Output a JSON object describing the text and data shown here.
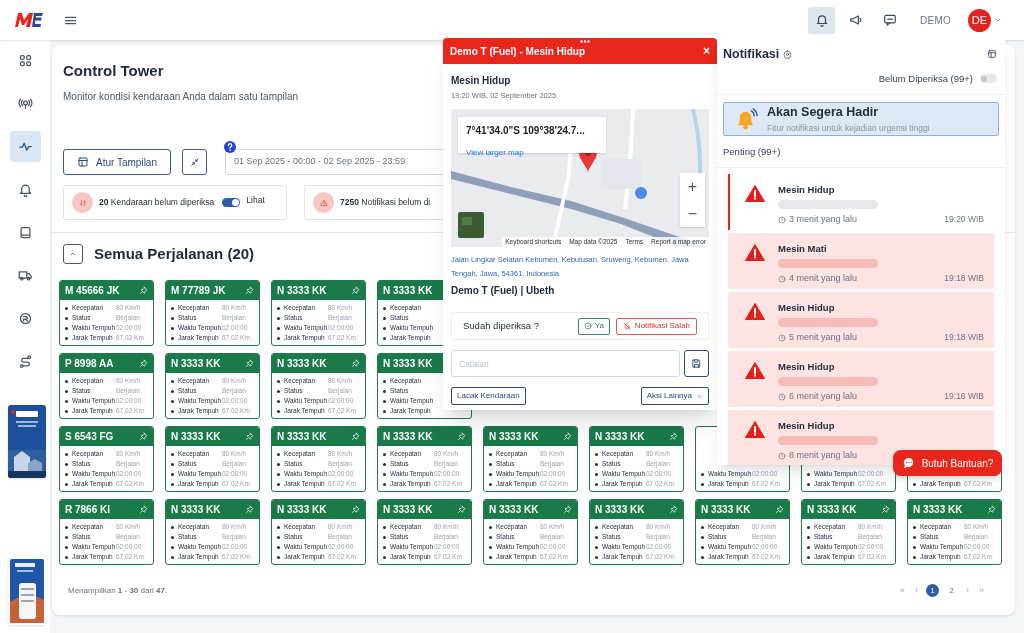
{
  "header": {
    "icons": [
      {
        "selected": true
      },
      {
        "selected": false
      },
      {
        "selected": false
      }
    ],
    "user": "DEMO",
    "avatar": "DE"
  },
  "sidebar": {
    "items": [
      {
        "selected": false
      },
      {
        "selected": false
      },
      {
        "selected": true
      },
      {
        "selected": false
      },
      {
        "selected": false
      },
      {
        "selected": false
      },
      {
        "selected": false
      },
      {
        "selected": false
      }
    ]
  },
  "page": {
    "title": "Control Tower",
    "subtitle": "Monitor kondisi kendaraan Anda dalam satu tampilan"
  },
  "toolbar": {
    "layout_button": "Atur Tampilan",
    "date_range": "01 Sep 2025 - 00:00 - 02 Sep 2025 - 23:59"
  },
  "stats": [
    {
      "kind": "vehicles",
      "text": "**20** Kendaraan belum diperiksa",
      "toggle": {
        "label": "Lihat",
        "on": true
      }
    },
    {
      "kind": "alerts",
      "text": "**7250** Notifikasi belum di"
    }
  ],
  "trips": {
    "title": "Semua Perjalanan (20)",
    "expanded": true,
    "cards": [
      {
        "kind": "card",
        "plate": "M 45666 JK",
        "fields": [
          {
            "label": "Kecepatan",
            "value": "80 Km/h"
          },
          {
            "label": "Status",
            "value": "Berjalan"
          },
          {
            "label": "Waktu Tempuh",
            "value": "02:00:00"
          },
          {
            "label": "Jarak Tempuh",
            "value": "67.02 Km"
          }
        ]
      },
      {
        "kind": "card",
        "plate": "M 77789 JK",
        "fields": [
          {
            "label": "Kecepatan",
            "value": "80 Km/h"
          },
          {
            "label": "Status",
            "value": "Berjalan"
          },
          {
            "label": "Waktu Tempuh",
            "value": "02:00:00"
          },
          {
            "label": "Jarak Tempuh",
            "value": "67.02 Km"
          }
        ]
      },
      {
        "kind": "card",
        "plate": "N 3333 KK",
        "fields": [
          {
            "label": "Kecepatan",
            "value": "80 Km/h"
          },
          {
            "label": "Status",
            "value": "Berjalan"
          },
          {
            "label": "Waktu Tempuh",
            "value": "02:00:00"
          },
          {
            "label": "Jarak Tempuh",
            "value": "67.02 Km"
          }
        ]
      },
      {
        "kind": "left",
        "plate": "N 3333 KK",
        "fields": [
          {
            "label": "Kecepatan"
          },
          {
            "label": "Status"
          },
          {
            "label": "Waktu Tempuh"
          },
          {
            "label": "Jarak Tempuh"
          }
        ]
      },
      {
        "kind": "hidden"
      },
      {
        "kind": "hidden"
      },
      {
        "kind": "hidden"
      },
      {
        "kind": "hidden"
      },
      {
        "kind": "hidden"
      },
      {
        "kind": "card",
        "plate": "P 8998 AA",
        "fields": [
          {
            "label": "Kecepatan",
            "value": "80 Km/h"
          },
          {
            "label": "Status",
            "value": "Berjalan"
          },
          {
            "label": "Waktu Tempuh",
            "value": "02:00:00"
          },
          {
            "label": "Jarak Tempuh",
            "value": "67.02 Km"
          }
        ]
      },
      {
        "kind": "card",
        "plate": "N 3333 KK",
        "fields": [
          {
            "label": "Kecepatan",
            "value": "80 Km/h"
          },
          {
            "label": "Status",
            "value": "Berjalan"
          },
          {
            "label": "Waktu Tempuh",
            "value": "02:00:00"
          },
          {
            "label": "Jarak Tempuh",
            "value": "67.02 Km"
          }
        ]
      },
      {
        "kind": "card",
        "plate": "N 3333 KK",
        "fields": [
          {
            "label": "Kecepatan",
            "value": "80 Km/h"
          },
          {
            "label": "Status",
            "value": "Berjalan"
          },
          {
            "label": "Waktu Tempuh",
            "value": "02:00:00"
          },
          {
            "label": "Jarak Tempuh",
            "value": "67.02 Km"
          }
        ]
      },
      {
        "kind": "left",
        "plate": "N 3333 KK",
        "fields": [
          {
            "label": "Kecepatan"
          },
          {
            "label": "Status"
          },
          {
            "label": "Waktu Tempuh"
          },
          {
            "label": "Jarak Tempuh"
          }
        ]
      },
      {
        "kind": "hidden"
      },
      {
        "kind": "hidden"
      },
      {
        "kind": "hidden"
      },
      {
        "kind": "hidden"
      },
      {
        "kind": "hidden"
      },
      {
        "kind": "card",
        "plate": "S 6543 FG",
        "fields": [
          {
            "label": "Kecepatan",
            "value": "80 Km/h"
          },
          {
            "label": "Status",
            "value": "Berjalan"
          },
          {
            "label": "Waktu Tempuh",
            "value": "02:00:00"
          },
          {
            "label": "Jarak Tempuh",
            "value": "67.02 Km"
          }
        ]
      },
      {
        "kind": "card",
        "plate": "N 3333 KK",
        "fields": [
          {
            "label": "Kecepatan",
            "value": "80 Km/h"
          },
          {
            "label": "Status",
            "value": "Berjalan"
          },
          {
            "label": "Waktu Tempuh",
            "value": "02:00:00"
          },
          {
            "label": "Jarak Tempuh",
            "value": "67.02 Km"
          }
        ]
      },
      {
        "kind": "card",
        "plate": "N 3333 KK",
        "fields": [
          {
            "label": "Kecepatan",
            "value": "80 Km/h"
          },
          {
            "label": "Status",
            "value": "Berjalan"
          },
          {
            "label": "Waktu Tempuh",
            "value": "02:00:00"
          },
          {
            "label": "Jarak Tempuh",
            "value": "67.02 Km"
          }
        ]
      },
      {
        "kind": "card",
        "plate": "N 3333 KK",
        "fields": [
          {
            "label": "Kecepatan",
            "value": "80 Km/h"
          },
          {
            "label": "Status",
            "value": "Berjalan"
          },
          {
            "label": "Waktu Tempuh",
            "value": "02:00:00"
          },
          {
            "label": "Jarak Tempuh",
            "value": "67.02 Km"
          }
        ]
      },
      {
        "kind": "card",
        "plate": "N 3333 KK",
        "fields": [
          {
            "label": "Kecepatan",
            "value": "80 Km/h"
          },
          {
            "label": "Status",
            "value": "Berjalan"
          },
          {
            "label": "Waktu Tempuh",
            "value": "02:00:00"
          },
          {
            "label": "Jarak Tempuh",
            "value": "67.02 Km"
          }
        ]
      },
      {
        "kind": "card",
        "plate": "N 3333 KK",
        "fields": [
          {
            "label": "Kecepatan",
            "value": "80 Km/h"
          },
          {
            "label": "Status",
            "value": "Berjalan"
          },
          {
            "label": "Waktu Tempuh",
            "value": "02:00:00"
          },
          {
            "label": "Jarak Tempuh",
            "value": "67.02 Km"
          }
        ]
      },
      {
        "kind": "bottom",
        "fields": [
          {
            "label": "Waktu Tempuh",
            "value": "02:00:00"
          },
          {
            "label": "Jarak Tempuh",
            "value": "67.02 Km"
          }
        ]
      },
      {
        "kind": "bottom",
        "fields": [
          {
            "label": "Waktu Tempuh",
            "value": "02:00:00"
          },
          {
            "label": "Jarak Tempuh",
            "value": "67.02 Km"
          }
        ]
      },
      {
        "kind": "bottom",
        "fields": [
          {
            "label": "Jarak Tempuh",
            "value": "67.02 Km"
          }
        ]
      },
      {
        "kind": "card",
        "plate": "R 7866 KI",
        "fields": [
          {
            "label": "Kecepatan",
            "value": "80 Km/h"
          },
          {
            "label": "Status",
            "value": "Berjalan"
          },
          {
            "label": "Waktu Tempuh",
            "value": "02:00:00"
          },
          {
            "label": "Jarak Tempuh",
            "value": "67.02 Km"
          }
        ]
      },
      {
        "kind": "card",
        "plate": "N 3333 KK",
        "fields": [
          {
            "label": "Kecepatan",
            "value": "80 Km/h"
          },
          {
            "label": "Status",
            "value": "Berjalan"
          },
          {
            "label": "Waktu Tempuh",
            "value": "02:00:00"
          },
          {
            "label": "Jarak Tempuh",
            "value": "67.02 Km"
          }
        ]
      },
      {
        "kind": "card",
        "plate": "N 3333 KK",
        "fields": [
          {
            "label": "Kecepatan",
            "value": "80 Km/h"
          },
          {
            "label": "Status",
            "value": "Berjalan"
          },
          {
            "label": "Waktu Tempuh",
            "value": "02:00:00"
          },
          {
            "label": "Jarak Tempuh",
            "value": "67.02 Km"
          }
        ]
      },
      {
        "kind": "card",
        "plate": "N 3333 KK",
        "fields": [
          {
            "label": "Kecepatan",
            "value": "80 Km/h"
          },
          {
            "label": "Status",
            "value": "Berjalan"
          },
          {
            "label": "Waktu Tempuh",
            "value": "02:00:00"
          },
          {
            "label": "Jarak Tempuh",
            "value": "67.02 Km"
          }
        ]
      },
      {
        "kind": "card",
        "plate": "N 3333 KK",
        "fields": [
          {
            "label": "Kecepatan",
            "value": "80 Km/h"
          },
          {
            "label": "Status",
            "value": "Berjalan"
          },
          {
            "label": "Waktu Tempuh",
            "value": "02:00:00"
          },
          {
            "label": "Jarak Tempuh",
            "value": "67.02 Km"
          }
        ]
      },
      {
        "kind": "card",
        "plate": "N 3333 KK",
        "fields": [
          {
            "label": "Kecepatan",
            "value": "80 Km/h"
          },
          {
            "label": "Status",
            "value": "Berjalan"
          },
          {
            "label": "Waktu Tempuh",
            "value": "02:00:00"
          },
          {
            "label": "Jarak Tempuh",
            "value": "67.02 Km"
          }
        ]
      },
      {
        "kind": "card",
        "plate": "N 3333 KK",
        "fields": [
          {
            "label": "Kecepatan",
            "value": "80 Km/h"
          },
          {
            "label": "Status",
            "value": "Berjalan"
          },
          {
            "label": "Waktu Tempuh",
            "value": "02:00:00"
          },
          {
            "label": "Jarak Tempuh",
            "value": "67.02 Km"
          }
        ]
      },
      {
        "kind": "card",
        "plate": "N 3333 KK",
        "fields": [
          {
            "label": "Kecepatan",
            "value": "80 Km/h"
          },
          {
            "label": "Status",
            "value": "Berjalan"
          },
          {
            "label": "Waktu Tempuh",
            "value": "02:00:00"
          },
          {
            "label": "Jarak Tempuh",
            "value": "67.02 Km"
          }
        ]
      },
      {
        "kind": "card",
        "plate": "N 3333 KK",
        "fields": [
          {
            "label": "Kecepatan",
            "value": "80 Km/h"
          },
          {
            "label": "Status",
            "value": "Berjalan"
          },
          {
            "label": "Waktu Tempuh",
            "value": "02:00:00"
          },
          {
            "label": "Jarak Tempuh",
            "value": "67.02 Km"
          }
        ]
      }
    ]
  },
  "pagination": {
    "summary": "Menampilkan **1** - **30** dari **47**.",
    "prev": [
      "«",
      "‹"
    ],
    "pages": [
      {
        "label": "1",
        "selected": true
      },
      {
        "label": "2",
        "selected": false
      }
    ],
    "next": [
      "›",
      "»"
    ]
  },
  "popup": {
    "title": "Demo T (Fuel) - Mesin Hidup",
    "close": "×",
    "event": "Mesin Hidup",
    "time": "19:20 WIB, 02 September 2025",
    "map": {
      "coords": "7°41'34.0\"S 109°38'24.7...",
      "larger_map": "View larger map",
      "zoom_in": "+",
      "zoom_out": "−",
      "attribution": [
        "Keyboard shortcuts",
        "Map data ©2025",
        "Terms",
        "Report a map error"
      ]
    },
    "address": "Jalan Lingkar Selatan Kebumen, Kebulusan, Sruweng, Kebumen, Jawa Tengah, Jawa, 54361, Indonesia",
    "vehicle": "Demo T (Fuel) | Ubeth",
    "check_question": "Sudah diperiksa ?",
    "confirm_button": "Ya",
    "false_alarm_button": "Notifikasi Salah",
    "note_placeholder": "Catatan",
    "track_button": "Lacak Kendaraan",
    "more_button": "Aksi Lainnya"
  },
  "notifications": {
    "title": "Notifikasi",
    "filter": {
      "label": "Belum Diperiksa (99+)",
      "on": false
    },
    "banner": {
      "title": "Akan Segera Hadir",
      "text": "Fitur notifikasi untuk kejadian urgensi tinggi"
    },
    "section": "Penting (99+)",
    "items": [
      {
        "title": "Mesin Hidup",
        "ago": "3 menit yang lalu",
        "time": "19:20 WIB",
        "selected": true
      },
      {
        "title": "Mesin Mati",
        "ago": "4 menit yang lalu",
        "time": "19:18 WIB",
        "selected": false
      },
      {
        "title": "Mesin Hidup",
        "ago": "5 menit yang lalu",
        "time": "19:18 WIB",
        "selected": false
      },
      {
        "title": "Mesin Hidup",
        "ago": "6 menit yang lalu",
        "time": "19:16 WIB",
        "selected": false
      },
      {
        "title": "Mesin Hidup",
        "ago": "8 menit yang lalu",
        "selected": false
      }
    ]
  },
  "help_button": "Butuh Bantuan?"
}
